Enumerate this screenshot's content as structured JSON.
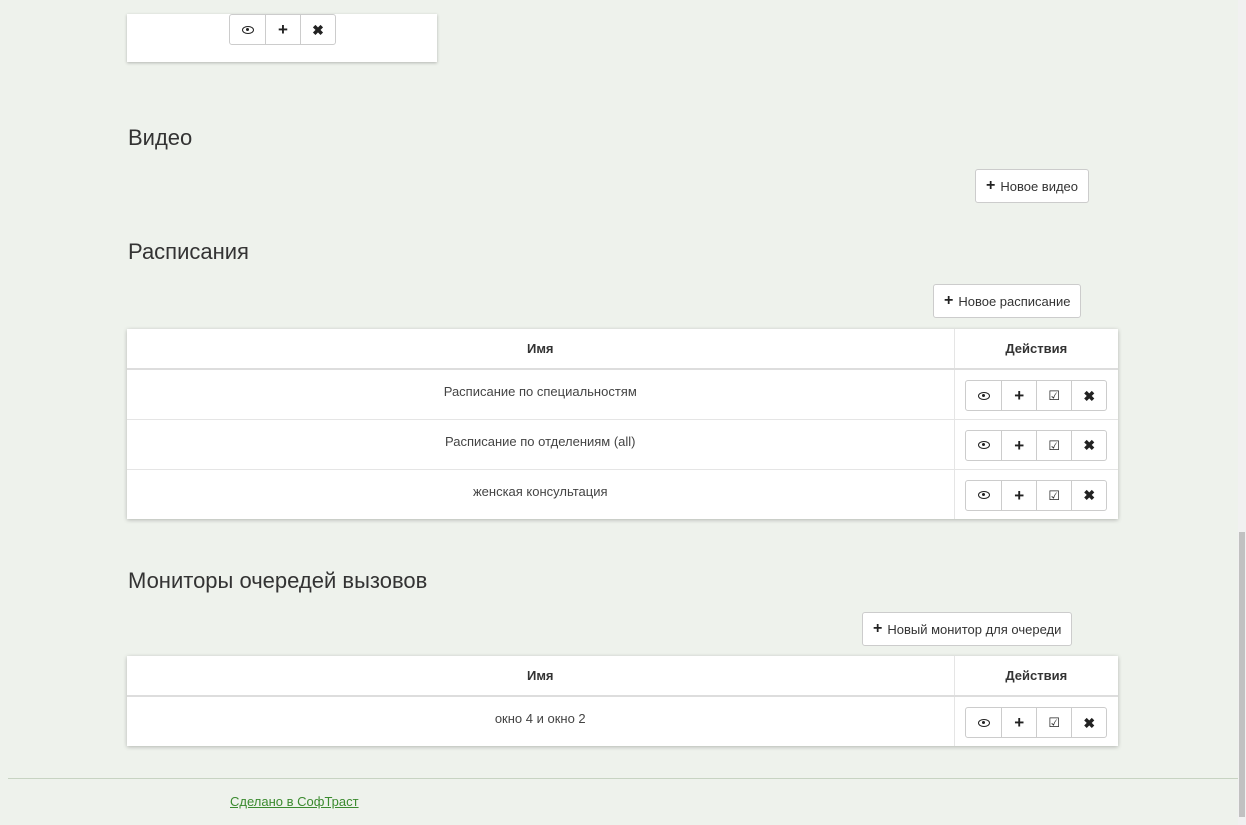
{
  "sections": {
    "video": {
      "title": "Видео",
      "new_button": "Новое видео"
    },
    "schedules": {
      "title": "Расписания",
      "new_button": "Новое расписание",
      "columns": {
        "name": "Имя",
        "actions": "Действия"
      },
      "rows": [
        {
          "name": "Расписание по специальностям"
        },
        {
          "name": "Расписание по отделениям (all)"
        },
        {
          "name": "женская консультация"
        }
      ]
    },
    "monitors": {
      "title": "Мониторы очередей вызовов",
      "new_button": "Новый монитор для очереди",
      "columns": {
        "name": "Имя",
        "actions": "Действия"
      },
      "rows": [
        {
          "name": "окно 4 и окно 2"
        }
      ]
    }
  },
  "icons": {
    "view": "eye-icon",
    "add": "plus-icon",
    "edit": "edit-icon",
    "delete": "close-icon",
    "plus_glyph": "+",
    "x_glyph": "✖",
    "edit_glyph": "☑"
  },
  "footer": {
    "link": "Сделано в СофТраст"
  },
  "colors": {
    "background": "#eef2ec",
    "link": "#3a8a2e"
  }
}
